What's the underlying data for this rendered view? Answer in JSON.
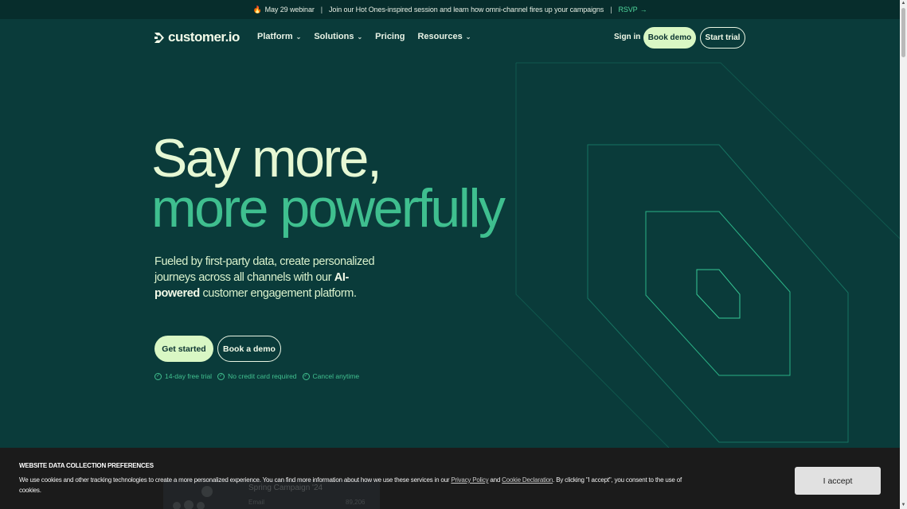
{
  "announcement": {
    "date": "May 29 webinar",
    "separator": "|",
    "message": "Join our Hot Ones-inspired session and learn how omni-channel fires up your campaigns",
    "cta": "RSVP",
    "cta_arrow": "→"
  },
  "nav": {
    "logo_text": "customer.io",
    "items": [
      {
        "label": "Platform",
        "has_dropdown": true
      },
      {
        "label": "Solutions",
        "has_dropdown": true
      },
      {
        "label": "Pricing",
        "has_dropdown": false
      },
      {
        "label": "Resources",
        "has_dropdown": true
      }
    ],
    "chevron": "⌄",
    "sign_in": "Sign in",
    "book_demo": "Book demo",
    "start_trial": "Start trial"
  },
  "hero": {
    "title_line1": "Say more,",
    "title_line2": "more powerfully",
    "subtitle_part1": "Fueled by first-party data, create personalized journeys across all channels with our ",
    "subtitle_bold": "AI-powered",
    "subtitle_part2": " customer engagement platform.",
    "get_started": "Get started",
    "book_a_demo": "Book a demo",
    "features": [
      "14-day free trial",
      "No credit card required",
      "Cancel anytime"
    ],
    "check_glyph": "✓"
  },
  "preview": {
    "title": "Spring Campaign '24",
    "channel": "Email",
    "value": "89,206"
  },
  "cookie_banner": {
    "title": "WEBSITE DATA COLLECTION PREFERENCES",
    "text_before": "We use cookies and other tracking technologies to create a more personalized experience. You can find more information about how we use these services in our ",
    "privacy_link": "Privacy Policy",
    "text_and": " and ",
    "cookie_link": "Cookie Declaration",
    "text_after": ". By clicking \"I accept\", you consent to the use of cookies.",
    "accept": "I accept"
  },
  "colors": {
    "background": "#0a3b3a",
    "announce_bg": "#072d2c",
    "accent_green": "#3fbf8f",
    "button_light": "#d9f7c4",
    "title_light": "#e6f8d4"
  }
}
